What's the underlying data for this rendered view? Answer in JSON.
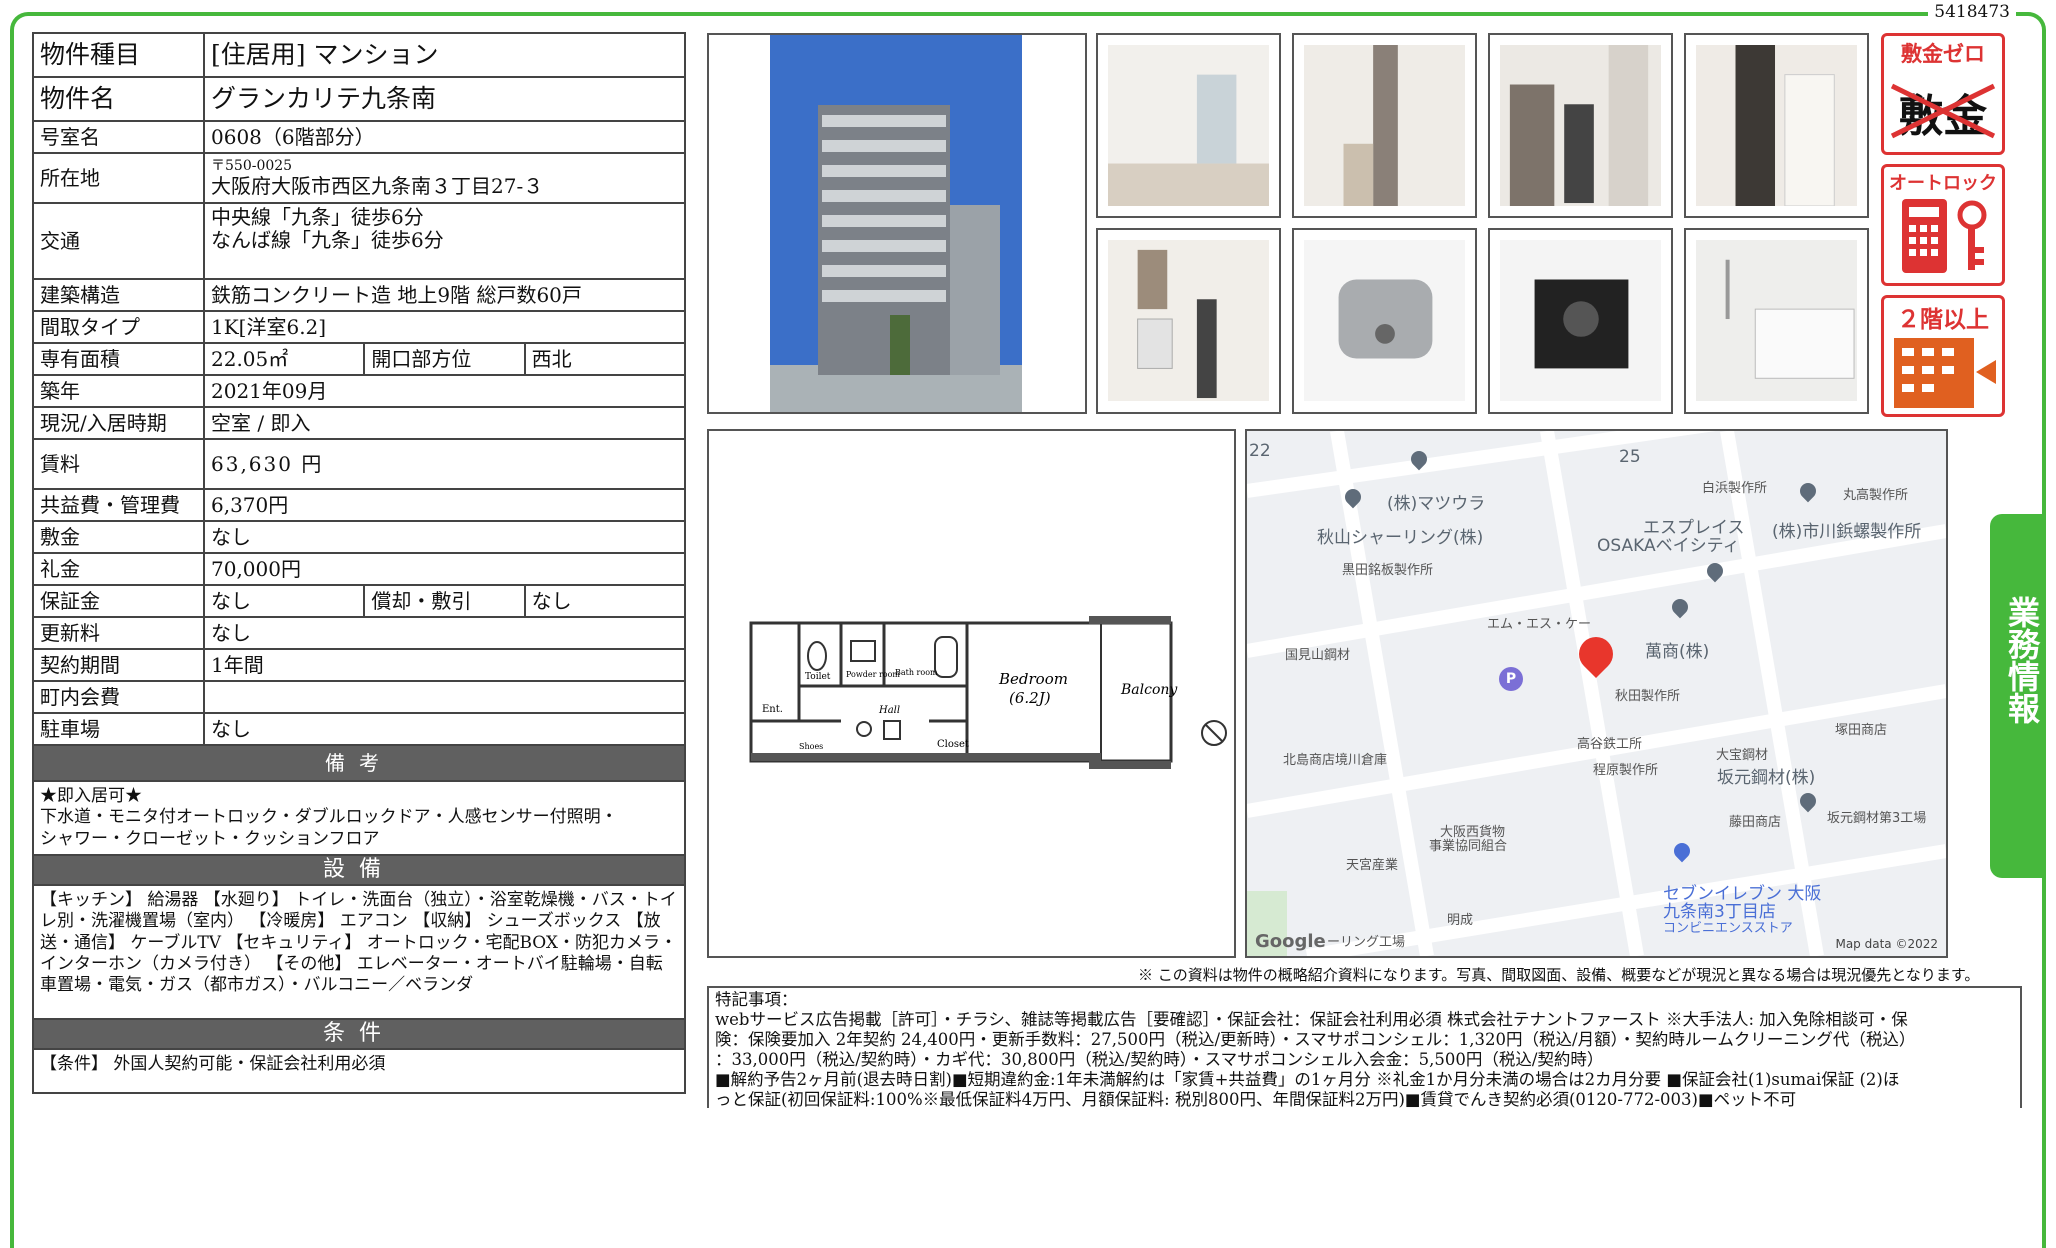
{
  "doc_id": "5418473",
  "rows": {
    "type_k": "物件種目",
    "type_v": "[住居用] マンション",
    "name_k": "物件名",
    "name_v": "グランカリテ九条南",
    "room_k": "号室名",
    "room_v": "0608（6階部分）",
    "addr_k": "所在地",
    "addr_zip": "〒550-0025",
    "addr_v": "大阪府大阪市西区九条南３丁目27-３",
    "access_k": "交通",
    "access_1": "中央線「九条」徒歩6分",
    "access_2": "なんば線「九条」徒歩6分",
    "struct_k": "建築構造",
    "struct_v": "鉄筋コンクリート造 地上9階 総戸数60戸",
    "layout_k": "間取タイプ",
    "layout_v": "1K[洋室6.2]",
    "area_k": "専有面積",
    "area_v": "22.05㎡",
    "dir_k": "開口部方位",
    "dir_v": "西北",
    "built_k": "築年",
    "built_v": "2021年09月",
    "status_k": "現況/入居時期",
    "status_v": "空室 / 即入",
    "rent_k": "賃料",
    "rent_v": "63,630 円",
    "fee_k": "共益費・管理費",
    "fee_v": "6,370円",
    "deposit_k": "敷金",
    "deposit_v": "なし",
    "key_k": "礼金",
    "key_v": "70,000円",
    "guar_k": "保証金",
    "guar_v": "なし",
    "amort_k": "償却・敷引",
    "amort_v": "なし",
    "renew_k": "更新料",
    "renew_v": "なし",
    "term_k": "契約期間",
    "term_v": "1年間",
    "town_k": "町内会費",
    "town_v": "",
    "park_k": "駐車場",
    "park_v": "なし"
  },
  "remarks_title": "備考",
  "remarks": [
    "★即入居可★",
    "下水道・モニタ付オートロック・ダブルロックドア・人感センサー付照明・",
    "シャワー・クローゼット・クッションフロア"
  ],
  "facilities_title": "設備",
  "facilities": "【キッチン】 給湯器 【水廻り】 トイレ・洗面台（独立）・浴室乾燥機・バス・トイレ別・洗濯機置場（室内） 【冷暖房】 エアコン 【収納】 シューズボックス 【放送・通信】 ケーブルTV 【セキュリティ】 オートロック・宅配BOX・防犯カメラ・インターホン（カメラ付き） 【その他】 エレベーター・オートバイ駐輪場・自転車置場・電気・ガス（都市ガス）・バルコニー／ベランダ",
  "conditions_title": "条件",
  "conditions": "【条件】 外国人契約可能・保証会社利用必須",
  "badges": {
    "deposit_zero": "敷金ゼロ",
    "deposit_cross": "敷金",
    "autolock": "オートロック",
    "floor2": "２階以上"
  },
  "floorplan": {
    "bedroom": "Bedroom",
    "bedroom_size": "(6.2J)",
    "balcony": "Balcony",
    "toilet": "Toilet",
    "powder": "Powder room",
    "bath": "Bath room",
    "hall": "Hall",
    "closet": "Closet",
    "ent": "Ent.",
    "shoes": "Shoes"
  },
  "map": {
    "labels": [
      "(株)マツウラ",
      "秋山シャーリング(株)",
      "黒田銘板製作所",
      "白浜製作所",
      "丸高製作所",
      "エスプレイス",
      "OSAKAベイシティ",
      "(株)市川鋲螺製作所",
      "エム・エス・ケー",
      "萬商(株)",
      "国見山鋼材",
      "秋田製作所",
      "高谷鉄工所",
      "北島商店境川倉庫",
      "程原製作所",
      "塚田商店",
      "大宝鋼材",
      "坂元鋼材(株)",
      "藤田商店",
      "坂元鋼材第3工場",
      "大阪西貨物",
      "事業協同組合",
      "天宮産業",
      "明成",
      "セブンイレブン 大阪",
      "九条南3丁目店",
      "コンビニエンスストア",
      "ーリング工場",
      "22",
      "25"
    ],
    "google": "Google",
    "copyright": "Map data ©2022"
  },
  "note": "※ この資料は物件の概略紹介資料になります。写真、間取図面、設備、概要などが現況と異なる場合は現況優先となります。",
  "special": [
    "特記事項：",
    "webサービス広告掲載［許可］・チラシ、雑誌等掲載広告［要確認］・保証会社：保証会社利用必須 株式会社テナントファースト ※大手法人: 加入免除相談可・保",
    "険：保険要加入 2年契約 24,400円・更新手数料：27,500円（税込/更新時）・スマサポコンシェル：1,320円（税込/月額）・契約時ルームクリーニング代（税込）",
    "：33,000円（税込/契約時）・カギ代：30,800円（税込/契約時）・スマサポコンシェル入会金：5,500円（税込/契約時）",
    "■解約予告2ヶ月前(退去時日割)■短期違約金:1年未満解約は「家賃+共益費」の1ヶ月分 ※礼金1か月分未満の場合は2カ月分要 ■保証会社(1)sumai保証 (2)ほ",
    "っと保証(初回保証料:100%※最低保証料4万円、月額保証料: 税別800円、年間保証料2万円)■賃貸でんき契約必須(0120-772-003)■ペット不可"
  ],
  "side_tab": "業務情報"
}
